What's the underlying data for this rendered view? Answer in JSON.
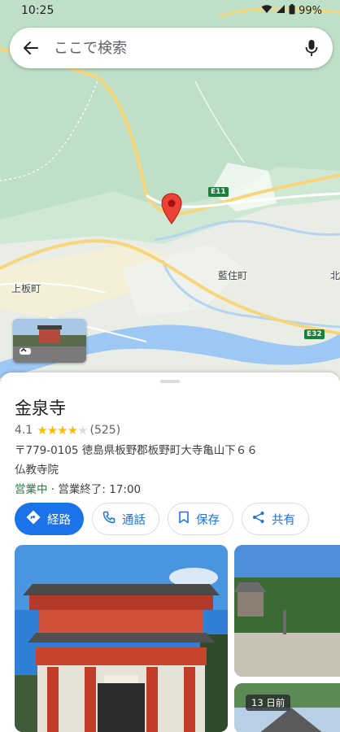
{
  "status_bar": {
    "time": "10:25",
    "battery": "99%"
  },
  "search": {
    "placeholder": "ここで検索"
  },
  "map": {
    "labels": {
      "kamiita": "上板町",
      "aizumi": "藍住町",
      "kita": "北"
    },
    "road_shields": {
      "e11": "E11",
      "e32": "E32"
    }
  },
  "place": {
    "name": "金泉寺",
    "rating": "4.1",
    "rating_stars": 4.1,
    "review_count": "(525)",
    "address": "〒779-0105 徳島県板野郡板野町大寺亀山下６６",
    "category": "仏教寺院",
    "hours": {
      "status": "営業中",
      "separator": " · ",
      "detail": "営業終了: 17:00"
    }
  },
  "actions": [
    {
      "label": "経路"
    },
    {
      "label": "通話"
    },
    {
      "label": "保存"
    },
    {
      "label": "共有"
    }
  ],
  "photos": {
    "badge": "13 日前"
  },
  "colors": {
    "accent": "#1a73e8",
    "open": "#188038",
    "pin": "#ea4335",
    "star": "#fbbc04"
  }
}
